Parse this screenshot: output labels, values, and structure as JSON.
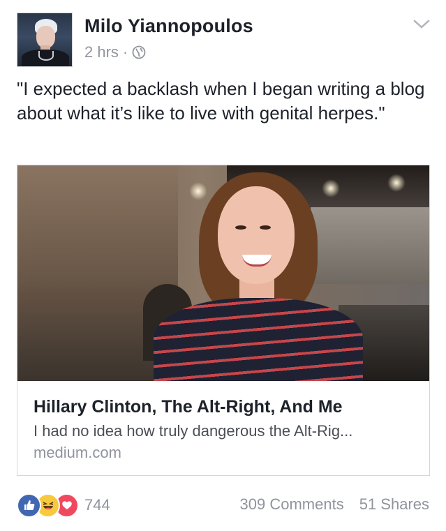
{
  "post": {
    "author": "Milo Yiannopoulos",
    "time": "2 hrs",
    "separator": "·",
    "audience_icon": "globe-icon",
    "menu_icon": "chevron-down-icon",
    "text": "\"I expected a backlash when I began writing a blog about what it’s like to live with genital herpes.\""
  },
  "link_card": {
    "title": "Hillary Clinton, The Alt-Right, And Me",
    "description": "I had no idea how truly dangerous the Alt-Rig...",
    "domain": "medium.com"
  },
  "footer": {
    "reactions": [
      "like-icon",
      "haha-icon",
      "love-icon"
    ],
    "reaction_count": "744",
    "comments": "309 Comments",
    "shares": "51 Shares"
  },
  "colors": {
    "author": "#1d2129",
    "muted": "#90949c",
    "like": "#4267b2",
    "haha": "#f7c93c",
    "love": "#f0495f"
  }
}
